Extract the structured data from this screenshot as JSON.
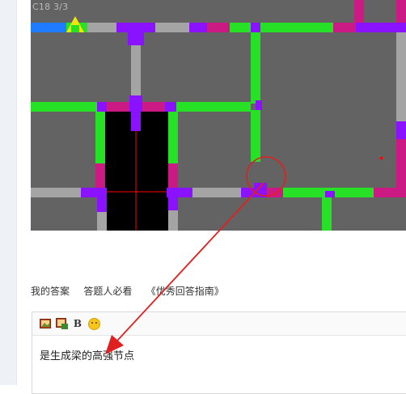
{
  "cad": {
    "label": "C18 3/3",
    "colors": {
      "background": "#636363",
      "beam_green": "#27e127",
      "beam_gray": "#a4a4a4",
      "column_purple": "#8a12ff",
      "column_magenta": "#cc1a85",
      "axis_blue": "#1f7bff",
      "highlight_fill": "#000000",
      "crosshair": "#ff0000"
    },
    "marker_icon": "yellow-triangle-icon"
  },
  "links": {
    "my_answer": "我的答案",
    "guide": "答题人必看",
    "excellent": "《优秀回答指南》"
  },
  "editor": {
    "toolbar_icons": [
      "image-icon",
      "insert-image-icon",
      "bold-icon",
      "emoji-icon"
    ],
    "bold_label": "B",
    "content": "是生成梁的高强节点"
  },
  "annotation": {
    "circle_color": "#e02020",
    "arrow_color": "#e02020"
  }
}
